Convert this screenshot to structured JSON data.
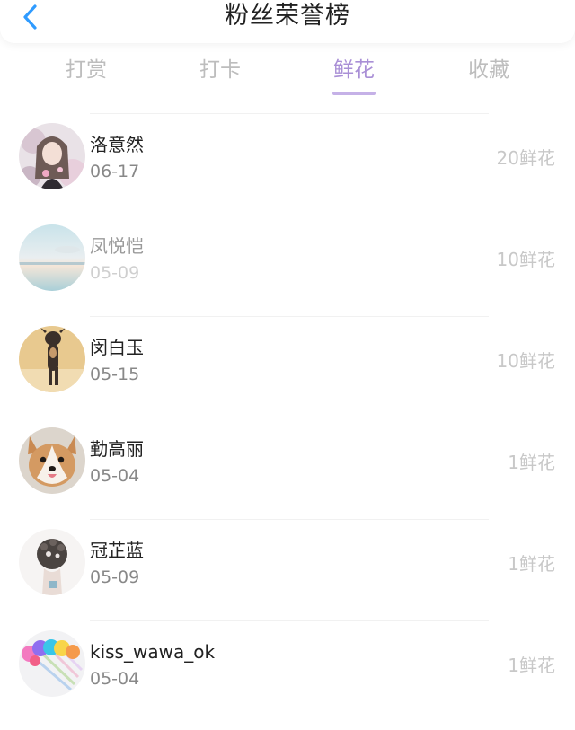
{
  "header": {
    "title": "粉丝荣誉榜",
    "back_icon": "chevron-left-icon",
    "back_color": "#2f9bff"
  },
  "tabs": [
    {
      "label": "打赏",
      "active": false
    },
    {
      "label": "打卡",
      "active": false
    },
    {
      "label": "鲜花",
      "active": true
    },
    {
      "label": "收藏",
      "active": false
    }
  ],
  "colors": {
    "accent": "#a98fd6",
    "indicator": "#c5b1e7",
    "muted": "#c8c8c8"
  },
  "fans": [
    {
      "name": "洛意然",
      "date": "06-17",
      "amount": "20鲜花",
      "avatar": "avatar-girl-flowers"
    },
    {
      "name": "凤悦恺",
      "date": "05-09",
      "amount": "10鲜花",
      "avatar": "avatar-sea-sky"
    },
    {
      "name": "闵白玉",
      "date": "05-15",
      "amount": "10鲜花",
      "avatar": "avatar-dog-standing"
    },
    {
      "name": "勤高丽",
      "date": "05-04",
      "amount": "1鲜花",
      "avatar": "avatar-corgi"
    },
    {
      "name": "冠芷蓝",
      "date": "05-09",
      "amount": "1鲜花",
      "avatar": "avatar-braided-hair"
    },
    {
      "name": "kiss_wawa_ok",
      "date": "05-04",
      "amount": "1鲜花",
      "avatar": "avatar-colorful-pens"
    }
  ]
}
